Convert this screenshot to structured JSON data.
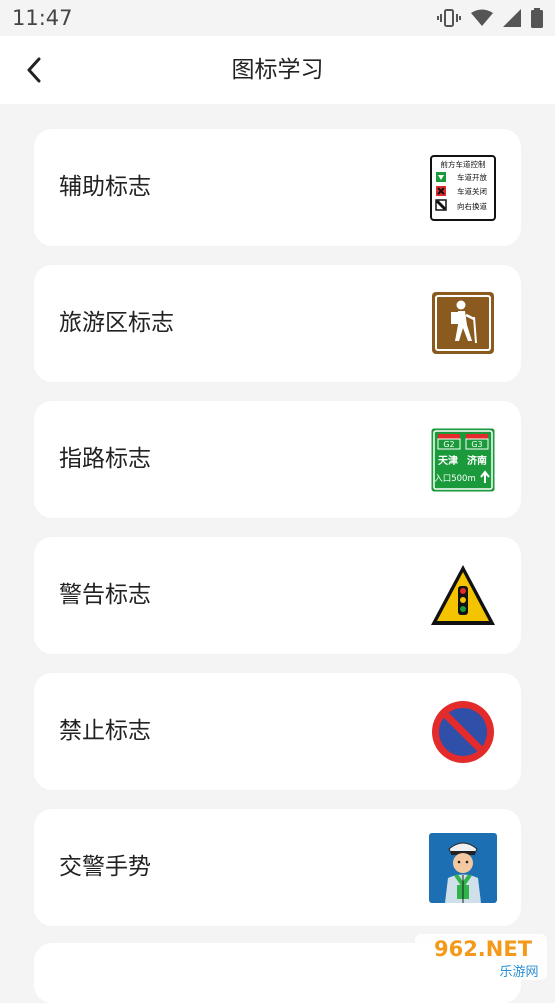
{
  "status_bar": {
    "time": "11:47"
  },
  "header": {
    "title": "图标学习"
  },
  "categories": [
    {
      "label": "辅助标志",
      "icon": "auxiliary-sign-icon"
    },
    {
      "label": "旅游区标志",
      "icon": "tourist-area-sign-icon"
    },
    {
      "label": "指路标志",
      "icon": "guide-sign-icon"
    },
    {
      "label": "警告标志",
      "icon": "warning-sign-icon"
    },
    {
      "label": "禁止标志",
      "icon": "prohibition-sign-icon"
    },
    {
      "label": "交警手势",
      "icon": "traffic-police-gesture-icon"
    }
  ],
  "sign_text": {
    "aux_title": "前方车道控制",
    "aux_row1": "车道开放",
    "aux_row2": "车道关闭",
    "aux_row3": "向右换道",
    "guide_route1": "G2",
    "guide_route2": "G3",
    "guide_city1": "天津",
    "guide_city2": "济南",
    "guide_exit": "入口500m"
  },
  "watermark": {
    "top": "962.NET",
    "bottom": "乐游网"
  },
  "colors": {
    "brown": "#8a5a1e",
    "green": "#1a9a3a",
    "warning_yellow": "#f5c400",
    "prohibit_red": "#e32b2b",
    "prohibit_blue": "#2f4fa8",
    "police_bg": "#1d6fb3"
  }
}
